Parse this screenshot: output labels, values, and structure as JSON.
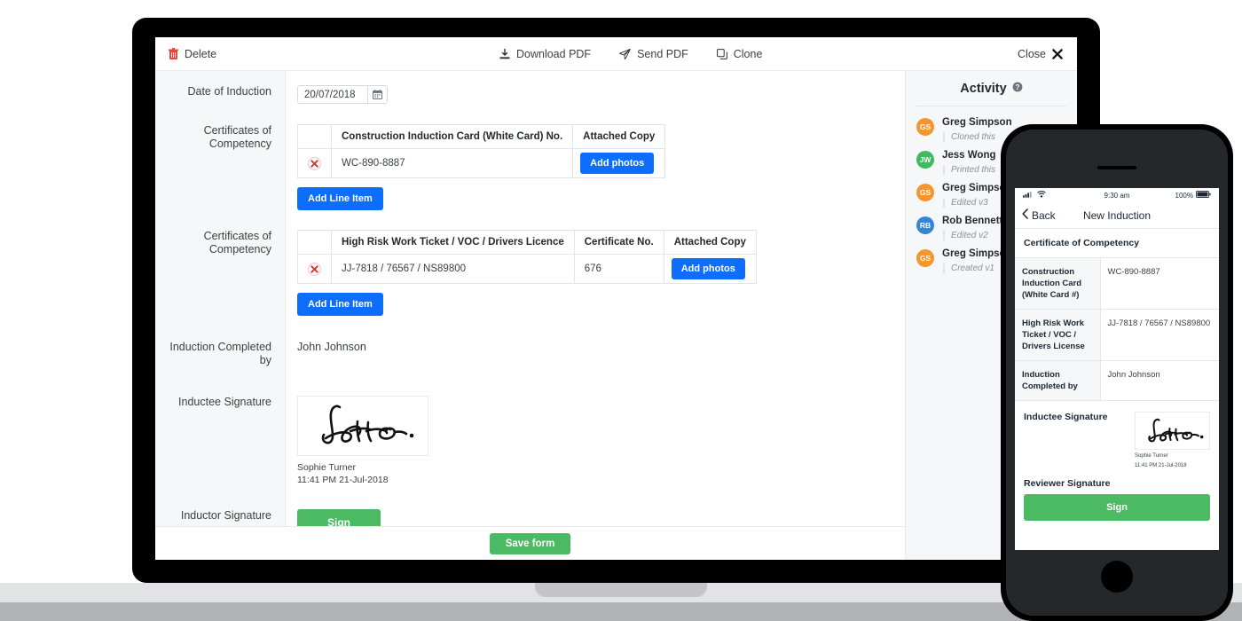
{
  "toolbar": {
    "delete_label": "Delete",
    "download_pdf_label": "Download PDF",
    "send_pdf_label": "Send PDF",
    "clone_label": "Clone",
    "close_label": "Close"
  },
  "form": {
    "date_row_label": "Date of Induction",
    "date_value": "20/07/2018",
    "cert1_row_label": "Certificates of Competency",
    "cert1_table": {
      "headers": [
        "",
        "Construction Induction Card (White Card) No.",
        "Attached Copy"
      ],
      "rows": [
        {
          "number": "WC-890-8887",
          "attach_label": "Add photos"
        }
      ],
      "add_line_label": "Add Line Item"
    },
    "cert2_row_label": "Certificates of Competency",
    "cert2_table": {
      "headers": [
        "",
        "High Risk Work Ticket / VOC / Drivers Licence",
        "Certificate No.",
        "Attached Copy"
      ],
      "rows": [
        {
          "ticket": "JJ-7818 / 76567 / NS89800",
          "cert_no": "676",
          "attach_label": "Add photos"
        }
      ],
      "add_line_label": "Add Line Item"
    },
    "completed_by_label": "Induction Completed by",
    "completed_by_value": "John Johnson",
    "inductee_sig_label": "Inductee Signature",
    "inductee_sig_name": "Sophie Turner",
    "inductee_sig_time": "11:41 PM 21-Jul-2018",
    "inductor_sig_label": "Inductor Signature",
    "sign_label": "Sign",
    "save_label": "Save form"
  },
  "activity": {
    "title": "Activity",
    "items": [
      {
        "initials": "GS",
        "name": "Greg Simpson",
        "action": "Cloned this",
        "color": "#f5952b"
      },
      {
        "initials": "JW",
        "name": "Jess Wong",
        "action": "Printed this",
        "color": "#3dbb5e"
      },
      {
        "initials": "GS",
        "name": "Greg Simpson",
        "action": "Edited v3",
        "color": "#f5952b"
      },
      {
        "initials": "RB",
        "name": "Rob Bennett",
        "action": "Edited v2",
        "color": "#3286d6"
      },
      {
        "initials": "GS",
        "name": "Greg Simpson",
        "action": "Created v1",
        "color": "#f5952b"
      }
    ]
  },
  "phone": {
    "status_time": "9:30 am",
    "status_battery": "100%",
    "back_label": "Back",
    "title": "New Induction",
    "section_label": "Certificate of Competency",
    "rows": [
      {
        "key": "Construction Induction Card (White Card #)",
        "value": "WC-890-8887"
      },
      {
        "key": "High Risk Work Ticket / VOC / Drivers License",
        "value": "JJ-7818 / 76567 / NS89800"
      },
      {
        "key": "Induction Completed by",
        "value": "John Johnson"
      }
    ],
    "inductee_sig_label": "Inductee Signature",
    "inductee_sig_name": "Sophie Turner",
    "inductee_sig_time": "11:41 PM 21-Jul-2018",
    "reviewer_sig_label": "Reviewer Signature",
    "sign_label": "Sign"
  },
  "colors": {
    "primary_blue": "#0d6efd",
    "green": "#4cb963",
    "danger_red": "#e8453c"
  }
}
